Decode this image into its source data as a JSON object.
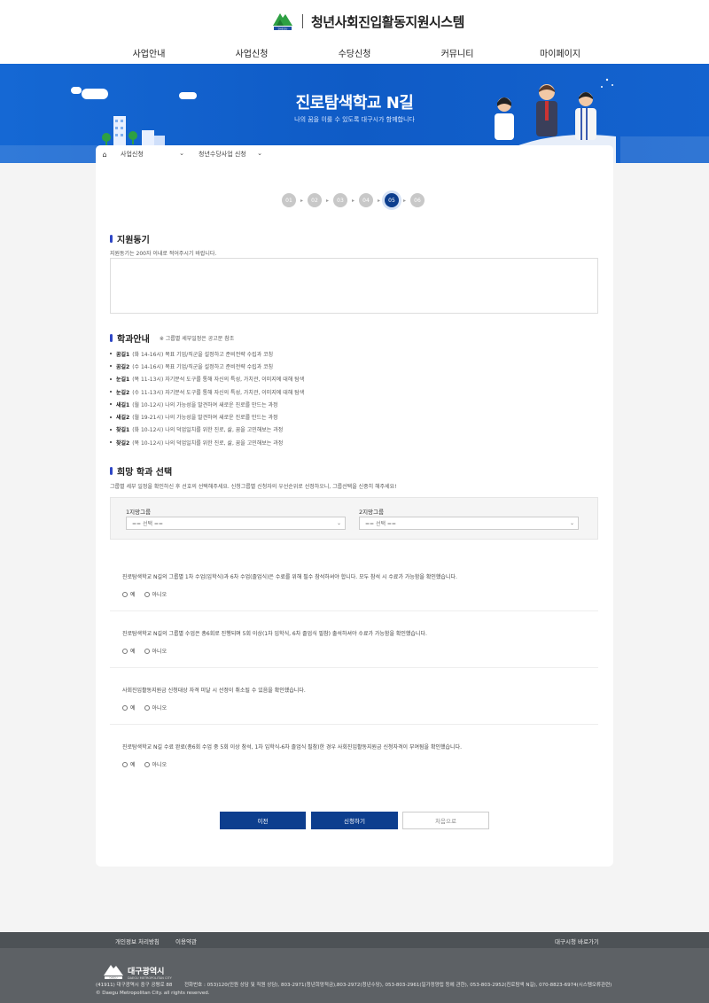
{
  "header": {
    "system_title": "청년사회진입활동지원시스템",
    "logo_small_text": "DAEGU",
    "nav": [
      "사업안내",
      "사업신청",
      "수당신청",
      "커뮤니티",
      "마이페이지"
    ]
  },
  "banner": {
    "title": "진로탐색학교 N길",
    "subtitle": "나의 꿈을 이룰 수 있도록 대구시가 함께합니다"
  },
  "breadcrumb": {
    "home_icon": "home-icon",
    "items": [
      "사업신청",
      "청년수당사업 신청"
    ]
  },
  "steps": {
    "items": [
      "01",
      "02",
      "03",
      "04",
      "05",
      "06"
    ],
    "active_index": 4
  },
  "motivation": {
    "title": "지원동기",
    "description": "지원동기는 200자 이내로 적어주시기 바랍니다.",
    "value": ""
  },
  "departments": {
    "title": "학과안내",
    "note": "※ 그룹별 세부일정은 공고문 참조",
    "items": [
      {
        "name": "꿈길1",
        "detail": "(화 14-16시) 목표 기업/직군을 설정하고 준비전략 수립과 코칭"
      },
      {
        "name": "꿈길2",
        "detail": "(수 14-16시) 목표 기업/직군을 설정하고 준비전략 수립과 코칭"
      },
      {
        "name": "눈길1",
        "detail": "(목 11-13시) 자기분석 도구를 통해 자신의 특성, 가치관, 이미지에 대해 탐색"
      },
      {
        "name": "눈길2",
        "detail": "(수 11-13시) 자기분석 도구를 통해 자신의 특성, 가치관, 이미지에 대해 탐색"
      },
      {
        "name": "새길1",
        "detail": "(월 10-12시) 나의 가능성을 발견하여 새로운 진로를 만드는 과정"
      },
      {
        "name": "새길2",
        "detail": "(월 19-21시) 나의 가능성을 발견하여 새로운 진로를 만드는 과정"
      },
      {
        "name": "찾길1",
        "detail": "(화 10-12시) 나의 덕업일치를 위한 진로, 삶, 꿈을 고민해보는 과정"
      },
      {
        "name": "찾길2",
        "detail": "(목 10-12시) 나의 덕업일치를 위한 진로, 삶, 꿈을 고민해보는 과정"
      }
    ]
  },
  "choice": {
    "title": "희망 학과 선택",
    "description": "그룹별 세부 일정을 확인하신 후 선호의 선택해주세요. 신청그룹별 신청자의 우선순위로 선정하오니, 그룹선택을 신중히 해주세요!",
    "first_label": "1지망그룹",
    "second_label": "2지망그룹",
    "first_value": "== 선택 ==",
    "second_value": "== 선택 =="
  },
  "agreements": [
    {
      "question": "진로탐색학교 N길의 그룹별 1차 수업(입학식)과 6차 수업(졸업식)은 수료를 위해 필수 참석하셔야 합니다. 모두 참석 시 수료가 가능함을 확인했습니다.",
      "yes": "예",
      "no": "아니오"
    },
    {
      "question": "진로탐색학교 N길의 그룹별 수업은 총6회로 진행되며 5회 이상(1차 입학식, 6차 졸업식 필참) 출석하셔야 수료가 가능함을 확인했습니다.",
      "yes": "예",
      "no": "아니오"
    },
    {
      "question": "사회진입활동지원금 신청대상 자격 미달 시 선정이 취소될 수 있음을 확인했습니다.",
      "yes": "예",
      "no": "아니오"
    },
    {
      "question": "진로탐색학교 N길 수료 완료(총6회 수업 중 5회 이상 참석, 1차 입학식-6차 졸업식 필참)한 경우 사회진입활동지원금 신청자격이 부여됨을 확인했습니다.",
      "yes": "예",
      "no": "아니오"
    }
  ],
  "buttons": {
    "prev": "이전",
    "apply": "신청하기",
    "first": "처음으로"
  },
  "colors": {
    "primary": "#0d3e8e",
    "banner": "#1568d4",
    "accent_bar": "#2f47c6"
  },
  "footer": {
    "links": [
      "개인정보 처리방침",
      "이용약관"
    ],
    "right_link": "대구시청 바로가기",
    "org_name": "대구광역시",
    "org_name_en": "DAEGU METROPOLITAN CITY",
    "logo_small_text": "DAEGU",
    "address": "(41911) 대구광역시 중구 공평로 88",
    "phone": "전화번호 : 053)120(민원 상담 및 직원 상담), 803-2971(청년희망적금),803-2972(청년수당), 053-803-2961(일가정양립 등에 관한), 053-803-2952(진로탐색 N길), 070-8823-6974(시스템오류관련)",
    "copyright": "© Daegu Metropolitan City. all rights reserved."
  }
}
